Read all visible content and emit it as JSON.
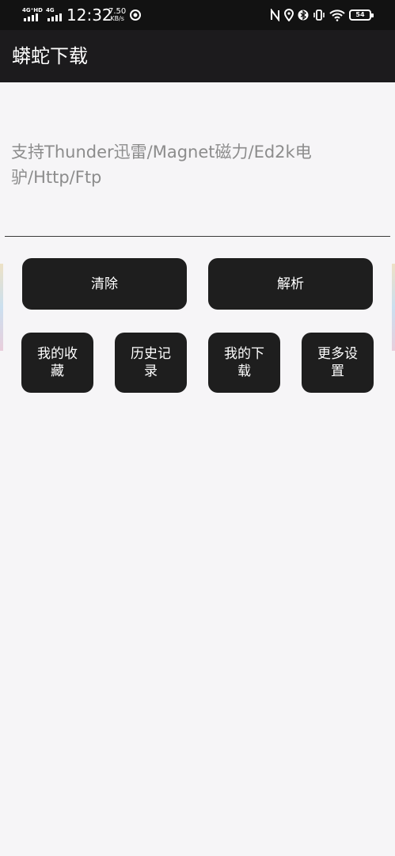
{
  "status_bar": {
    "network_1": "4G⁺HD",
    "network_2": "4G",
    "time": "12:32",
    "speed_value": "7.50",
    "speed_unit": "KB/s",
    "battery": "54",
    "icons": [
      "nfc-icon",
      "location-icon",
      "bluetooth-icon",
      "vibrate-icon",
      "wifi-icon",
      "battery-icon"
    ]
  },
  "app_bar": {
    "title": "蟒蛇下载"
  },
  "input": {
    "value": "",
    "placeholder": "支持Thunder迅雷/Magnet磁力/Ed2k电驴/Http/Ftp"
  },
  "actions": {
    "clear_label": "清除",
    "parse_label": "解析"
  },
  "shortcuts": {
    "favorites_label": "我的收藏",
    "history_label": "历史记录",
    "downloads_label": "我的下载",
    "settings_label": "更多设置"
  },
  "colors": {
    "app_bar": "#1c1b1d",
    "status_bar": "#121212",
    "button": "#1e1e1e",
    "background": "#f6f5f7",
    "placeholder": "#8c8c8c"
  }
}
